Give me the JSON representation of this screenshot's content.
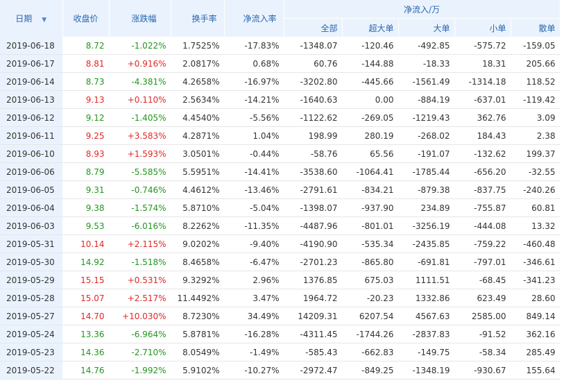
{
  "headers": {
    "date": "日期",
    "close": "收盘价",
    "change": "涨跌幅",
    "turnover": "换手率",
    "net_rate": "净流入率",
    "group": "净流入/万",
    "all": "全部",
    "super_big": "超大单",
    "big": "大单",
    "small": "小单",
    "retail": "散单"
  },
  "icons": {
    "sort": "sort-down-icon"
  },
  "colors": {
    "up": "#e12727",
    "down": "#21961e",
    "header_bg": "#eaf3fd",
    "header_text": "#2a65b0"
  },
  "rows": [
    {
      "date": "2019-06-18",
      "close": "8.72",
      "change": "-1.022%",
      "turnover": "1.7525%",
      "net_rate": "-17.83%",
      "all": "-1348.07",
      "super_big": "-120.46",
      "big": "-492.85",
      "small": "-575.72",
      "retail": "-159.05",
      "dir": "down"
    },
    {
      "date": "2019-06-17",
      "close": "8.81",
      "change": "+0.916%",
      "turnover": "2.0817%",
      "net_rate": "0.68%",
      "all": "60.76",
      "super_big": "-144.88",
      "big": "-18.33",
      "small": "18.31",
      "retail": "205.66",
      "dir": "up"
    },
    {
      "date": "2019-06-14",
      "close": "8.73",
      "change": "-4.381%",
      "turnover": "4.2658%",
      "net_rate": "-16.97%",
      "all": "-3202.80",
      "super_big": "-445.66",
      "big": "-1561.49",
      "small": "-1314.18",
      "retail": "118.52",
      "dir": "down"
    },
    {
      "date": "2019-06-13",
      "close": "9.13",
      "change": "+0.110%",
      "turnover": "2.5634%",
      "net_rate": "-14.21%",
      "all": "-1640.63",
      "super_big": "0.00",
      "big": "-884.19",
      "small": "-637.01",
      "retail": "-119.42",
      "dir": "up"
    },
    {
      "date": "2019-06-12",
      "close": "9.12",
      "change": "-1.405%",
      "turnover": "4.4540%",
      "net_rate": "-5.56%",
      "all": "-1122.62",
      "super_big": "-269.05",
      "big": "-1219.43",
      "small": "362.76",
      "retail": "3.09",
      "dir": "down"
    },
    {
      "date": "2019-06-11",
      "close": "9.25",
      "change": "+3.583%",
      "turnover": "4.2871%",
      "net_rate": "1.04%",
      "all": "198.99",
      "super_big": "280.19",
      "big": "-268.02",
      "small": "184.43",
      "retail": "2.38",
      "dir": "up"
    },
    {
      "date": "2019-06-10",
      "close": "8.93",
      "change": "+1.593%",
      "turnover": "3.0501%",
      "net_rate": "-0.44%",
      "all": "-58.76",
      "super_big": "65.56",
      "big": "-191.07",
      "small": "-132.62",
      "retail": "199.37",
      "dir": "up"
    },
    {
      "date": "2019-06-06",
      "close": "8.79",
      "change": "-5.585%",
      "turnover": "5.5951%",
      "net_rate": "-14.41%",
      "all": "-3538.60",
      "super_big": "-1064.41",
      "big": "-1785.44",
      "small": "-656.20",
      "retail": "-32.55",
      "dir": "down"
    },
    {
      "date": "2019-06-05",
      "close": "9.31",
      "change": "-0.746%",
      "turnover": "4.4612%",
      "net_rate": "-13.46%",
      "all": "-2791.61",
      "super_big": "-834.21",
      "big": "-879.38",
      "small": "-837.75",
      "retail": "-240.26",
      "dir": "down"
    },
    {
      "date": "2019-06-04",
      "close": "9.38",
      "change": "-1.574%",
      "turnover": "5.8710%",
      "net_rate": "-5.04%",
      "all": "-1398.07",
      "super_big": "-937.90",
      "big": "234.89",
      "small": "-755.87",
      "retail": "60.81",
      "dir": "down"
    },
    {
      "date": "2019-06-03",
      "close": "9.53",
      "change": "-6.016%",
      "turnover": "8.2262%",
      "net_rate": "-11.35%",
      "all": "-4487.96",
      "super_big": "-801.01",
      "big": "-3256.19",
      "small": "-444.08",
      "retail": "13.32",
      "dir": "down"
    },
    {
      "date": "2019-05-31",
      "close": "10.14",
      "change": "+2.115%",
      "turnover": "9.0202%",
      "net_rate": "-9.40%",
      "all": "-4190.90",
      "super_big": "-535.34",
      "big": "-2435.85",
      "small": "-759.22",
      "retail": "-460.48",
      "dir": "up"
    },
    {
      "date": "2019-05-30",
      "close": "14.92",
      "change": "-1.518%",
      "turnover": "8.4658%",
      "net_rate": "-6.47%",
      "all": "-2701.23",
      "super_big": "-865.80",
      "big": "-691.81",
      "small": "-797.01",
      "retail": "-346.61",
      "dir": "down"
    },
    {
      "date": "2019-05-29",
      "close": "15.15",
      "change": "+0.531%",
      "turnover": "9.3292%",
      "net_rate": "2.96%",
      "all": "1376.85",
      "super_big": "675.03",
      "big": "1111.51",
      "small": "-68.45",
      "retail": "-341.23",
      "dir": "up"
    },
    {
      "date": "2019-05-28",
      "close": "15.07",
      "change": "+2.517%",
      "turnover": "11.4492%",
      "net_rate": "3.47%",
      "all": "1964.72",
      "super_big": "-20.23",
      "big": "1332.86",
      "small": "623.49",
      "retail": "28.60",
      "dir": "up"
    },
    {
      "date": "2019-05-27",
      "close": "14.70",
      "change": "+10.030%",
      "turnover": "8.7230%",
      "net_rate": "34.49%",
      "all": "14209.31",
      "super_big": "6207.54",
      "big": "4567.63",
      "small": "2585.00",
      "retail": "849.14",
      "dir": "up"
    },
    {
      "date": "2019-05-24",
      "close": "13.36",
      "change": "-6.964%",
      "turnover": "5.8781%",
      "net_rate": "-16.28%",
      "all": "-4311.45",
      "super_big": "-1744.26",
      "big": "-2837.83",
      "small": "-91.52",
      "retail": "362.16",
      "dir": "down"
    },
    {
      "date": "2019-05-23",
      "close": "14.36",
      "change": "-2.710%",
      "turnover": "8.0549%",
      "net_rate": "-1.49%",
      "all": "-585.43",
      "super_big": "-662.83",
      "big": "-149.75",
      "small": "-58.34",
      "retail": "285.49",
      "dir": "down"
    },
    {
      "date": "2019-05-22",
      "close": "14.76",
      "change": "-1.992%",
      "turnover": "5.9102%",
      "net_rate": "-10.27%",
      "all": "-2972.47",
      "super_big": "-849.25",
      "big": "-1348.19",
      "small": "-930.67",
      "retail": "155.64",
      "dir": "down"
    }
  ]
}
